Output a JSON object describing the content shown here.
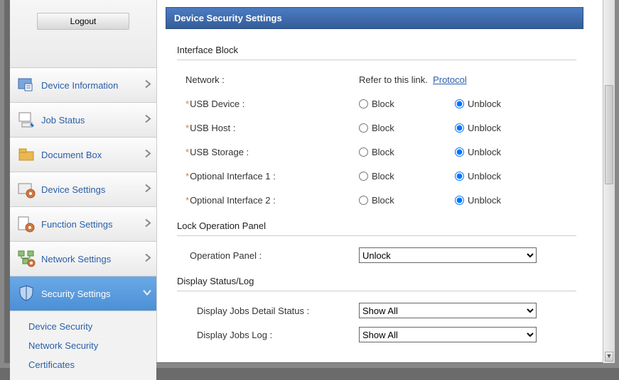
{
  "header": {
    "logout": "Logout",
    "title": "Device Security Settings"
  },
  "sidebar": {
    "items": [
      {
        "label": "Device Information"
      },
      {
        "label": "Job Status"
      },
      {
        "label": "Document Box"
      },
      {
        "label": "Device Settings"
      },
      {
        "label": "Function Settings"
      },
      {
        "label": "Network Settings"
      },
      {
        "label": "Security Settings"
      }
    ],
    "sub": [
      {
        "label": "Device Security"
      },
      {
        "label": "Network Security"
      },
      {
        "label": "Certificates"
      }
    ]
  },
  "sections": {
    "interface_block": {
      "title": "Interface Block",
      "network_label": "Network :",
      "network_note": "Refer to this link.",
      "protocol_link": "Protocol",
      "items": [
        {
          "label": "USB Device :"
        },
        {
          "label": "USB Host :"
        },
        {
          "label": "USB Storage :"
        },
        {
          "label": "Optional Interface 1 :"
        },
        {
          "label": "Optional Interface 2 :"
        }
      ],
      "block": "Block",
      "unblock": "Unblock"
    },
    "lock_panel": {
      "title": "Lock Operation Panel",
      "label": "Operation Panel :",
      "value": "Unlock"
    },
    "display_status": {
      "title": "Display Status/Log",
      "rows": [
        {
          "label": "Display Jobs Detail Status :",
          "value": "Show All"
        },
        {
          "label": "Display Jobs Log :",
          "value": "Show All"
        }
      ]
    }
  }
}
